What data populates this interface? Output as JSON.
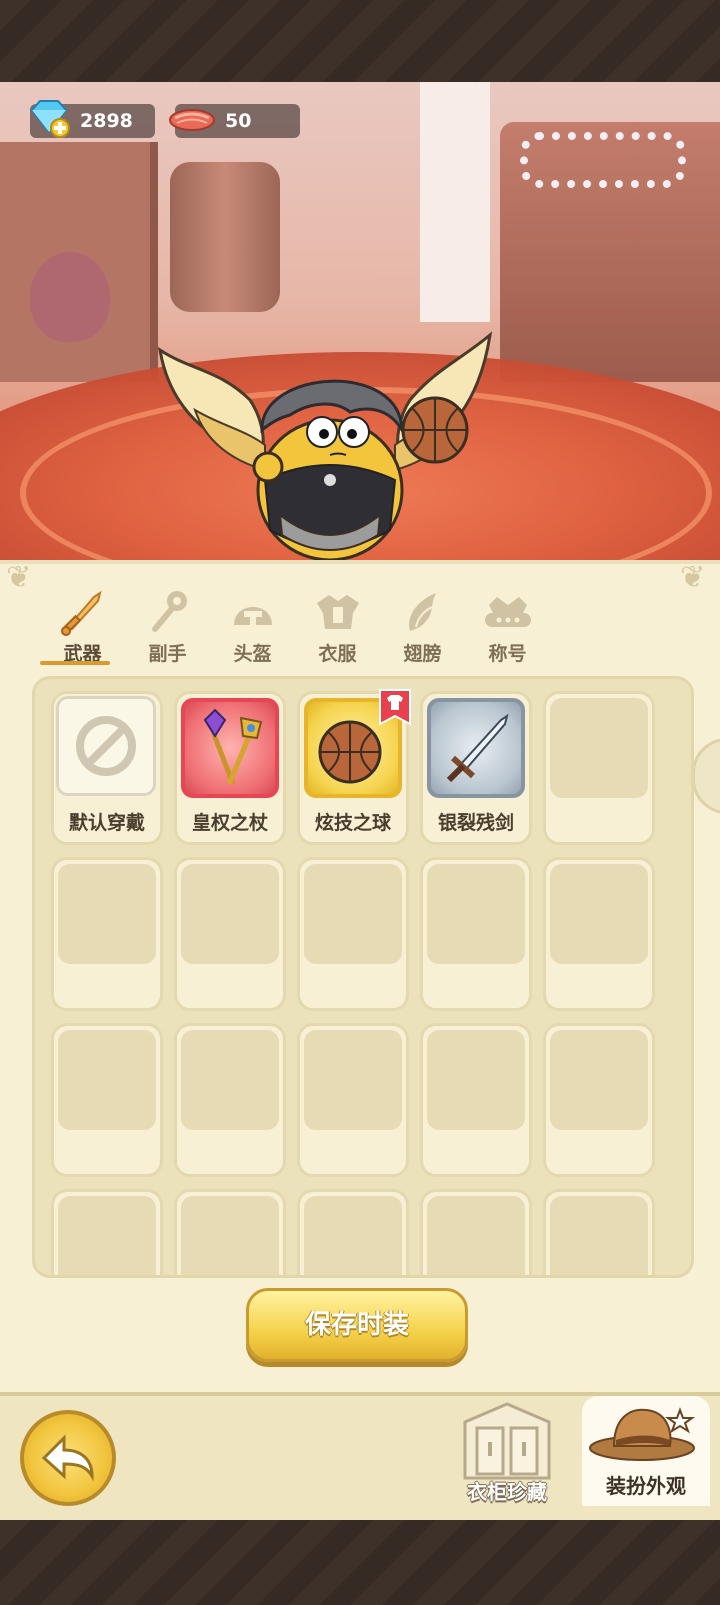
{
  "currencies": [
    {
      "icon": "diamond-icon",
      "value": "2898"
    },
    {
      "icon": "meat-icon",
      "value": "50"
    }
  ],
  "tabs": [
    {
      "label": "武器",
      "icon": "sword-icon",
      "active": true
    },
    {
      "label": "副手",
      "icon": "offhand-icon",
      "active": false
    },
    {
      "label": "头盔",
      "icon": "helmet-icon",
      "active": false
    },
    {
      "label": "衣服",
      "icon": "armor-icon",
      "active": false
    },
    {
      "label": "翅膀",
      "icon": "wing-icon",
      "active": false
    },
    {
      "label": "称号",
      "icon": "crown-icon",
      "active": false
    }
  ],
  "items": [
    {
      "label": "默认穿戴",
      "rarity": "default",
      "icon": "none-icon"
    },
    {
      "label": "皇权之杖",
      "rarity": "red",
      "icon": "scepter-icon"
    },
    {
      "label": "炫技之球",
      "rarity": "gold",
      "icon": "basketball-icon",
      "new": true
    },
    {
      "label": "银裂残剑",
      "rarity": "silver",
      "icon": "broken-sword-icon"
    }
  ],
  "buttons": {
    "save": "保存时装",
    "wardrobe": "衣柜珍藏",
    "dressup": "装扮外观"
  },
  "colors": {
    "accent": "#d99a30",
    "panel": "#f7f0d4",
    "red_rarity": "#e84655",
    "gold_rarity": "#e8b52a",
    "silver_rarity": "#8795a3"
  }
}
